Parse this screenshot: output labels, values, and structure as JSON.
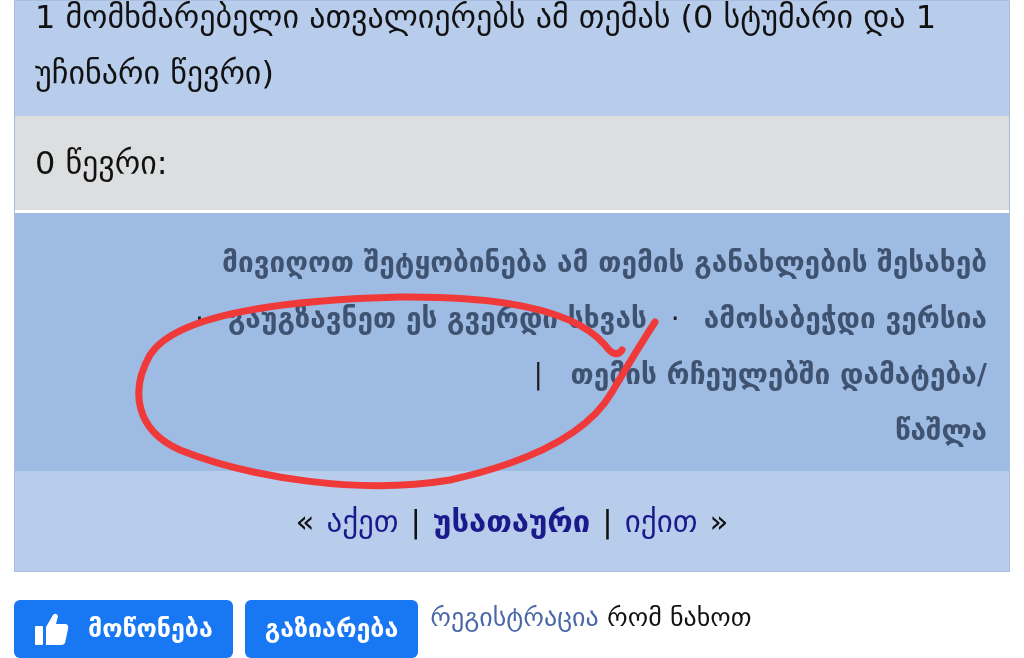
{
  "online_text": "1 მომხმარებელი ათვალიერებს ამ თემას (0 სტუმარი და 1 უჩინარი წევრი)",
  "members_label": "0 წევრი:",
  "actions": [
    {
      "kind": "link",
      "label": "მივიღოთ შეტყობინება ამ თემის განახლების შესახებ"
    },
    {
      "kind": "separator",
      "label": "·"
    },
    {
      "kind": "link",
      "label": "გაუგზავნეთ ეს გვერდი სხვას"
    },
    {
      "kind": "separator",
      "label": "·"
    },
    {
      "kind": "link",
      "label": "ამოსაბეჭდი ვერსია"
    },
    {
      "kind": "separator",
      "label": "|"
    },
    {
      "kind": "link",
      "label": "თემის რჩეულებში დამატება/წაშლა"
    }
  ],
  "pagination": [
    {
      "kind": "mark",
      "label": "«"
    },
    {
      "kind": "link",
      "label": "აქეთ"
    },
    {
      "kind": "separator",
      "label": "|"
    },
    {
      "kind": "current",
      "label": "უსათაური"
    },
    {
      "kind": "separator",
      "label": "|"
    },
    {
      "kind": "link",
      "label": "იქით"
    },
    {
      "kind": "mark",
      "label": "»"
    }
  ],
  "buttons": [
    {
      "kind": "like",
      "label": "მოწონება"
    },
    {
      "kind": "share",
      "label": "გაზიარება"
    }
  ],
  "register": {
    "link": "რეგისტრაცია",
    "text": "რომ ნახოთ"
  }
}
